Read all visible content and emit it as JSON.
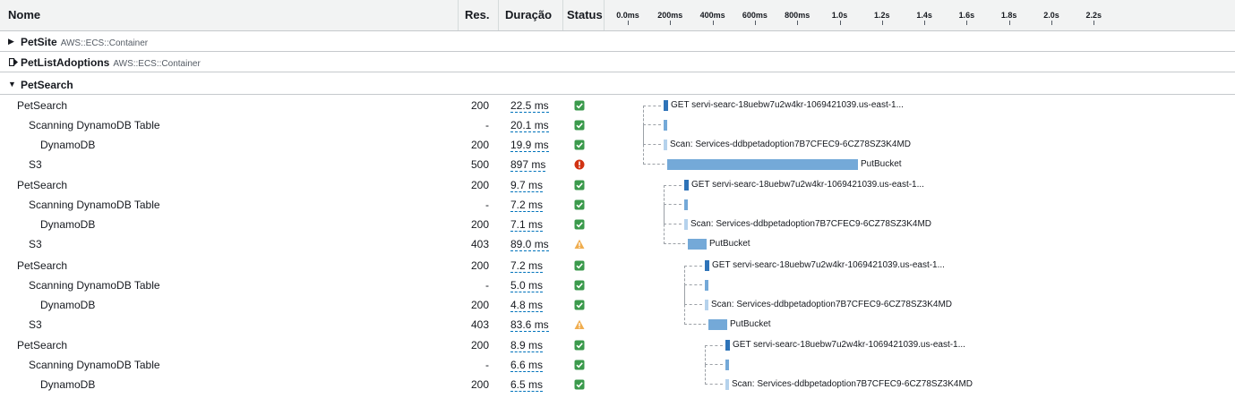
{
  "columns": {
    "name": "Nome",
    "res": "Res.",
    "duration": "Duração",
    "status": "Status"
  },
  "timeline": {
    "ticks": [
      "0.0ms",
      "200ms",
      "400ms",
      "600ms",
      "800ms",
      "1.0s",
      "1.2s",
      "1.4s",
      "1.6s",
      "1.8s",
      "2.0s",
      "2.2s"
    ]
  },
  "groups": [
    {
      "name": "PetSite",
      "type": "AWS::ECS::Container",
      "state": "collapsed"
    },
    {
      "name": "PetListAdoptions",
      "type": "AWS::ECS::Container",
      "state": "container"
    },
    {
      "name": "PetSearch",
      "type": "",
      "state": "expanded"
    }
  ],
  "rows": [
    {
      "name": "PetSearch",
      "res": "200",
      "duration": "22.5 ms",
      "status": "ok",
      "label": "GET servi-searc-18uebw7u2w4kr-1069421039.us-east-1..."
    },
    {
      "name": "Scanning DynamoDB Table",
      "res": "-",
      "duration": "20.1 ms",
      "status": "ok",
      "label": ""
    },
    {
      "name": "DynamoDB",
      "res": "200",
      "duration": "19.9 ms",
      "status": "ok",
      "label": "Scan: Services-ddbpetadoption7B7CFEC9-6CZ78SZ3K4MD"
    },
    {
      "name": "S3",
      "res": "500",
      "duration": "897 ms",
      "status": "error",
      "label": "PutBucket"
    },
    {
      "name": "PetSearch",
      "res": "200",
      "duration": "9.7 ms",
      "status": "ok",
      "label": "GET servi-searc-18uebw7u2w4kr-1069421039.us-east-1..."
    },
    {
      "name": "Scanning DynamoDB Table",
      "res": "-",
      "duration": "7.2 ms",
      "status": "ok",
      "label": ""
    },
    {
      "name": "DynamoDB",
      "res": "200",
      "duration": "7.1 ms",
      "status": "ok",
      "label": "Scan: Services-ddbpetadoption7B7CFEC9-6CZ78SZ3K4MD"
    },
    {
      "name": "S3",
      "res": "403",
      "duration": "89.0 ms",
      "status": "warning",
      "label": "PutBucket"
    },
    {
      "name": "PetSearch",
      "res": "200",
      "duration": "7.2 ms",
      "status": "ok",
      "label": "GET servi-searc-18uebw7u2w4kr-1069421039.us-east-1..."
    },
    {
      "name": "Scanning DynamoDB Table",
      "res": "-",
      "duration": "5.0 ms",
      "status": "ok",
      "label": ""
    },
    {
      "name": "DynamoDB",
      "res": "200",
      "duration": "4.8 ms",
      "status": "ok",
      "label": "Scan: Services-ddbpetadoption7B7CFEC9-6CZ78SZ3K4MD"
    },
    {
      "name": "S3",
      "res": "403",
      "duration": "83.6 ms",
      "status": "warning",
      "label": "PutBucket"
    },
    {
      "name": "PetSearch",
      "res": "200",
      "duration": "8.9 ms",
      "status": "ok",
      "label": "GET servi-searc-18uebw7u2w4kr-1069421039.us-east-1..."
    },
    {
      "name": "Scanning DynamoDB Table",
      "res": "-",
      "duration": "6.6 ms",
      "status": "ok",
      "label": ""
    },
    {
      "name": "DynamoDB",
      "res": "200",
      "duration": "6.5 ms",
      "status": "ok",
      "label": "Scan: Services-ddbpetadoption7B7CFEC9-6CZ78SZ3K4MD"
    }
  ],
  "colors": {
    "ok": "#3b9a4c",
    "error": "#d13212",
    "warning": "#f0ad4e",
    "segment_dark": "#2e73b8",
    "segment_mid": "#74a9d8",
    "segment_light": "#b5d2ec"
  }
}
